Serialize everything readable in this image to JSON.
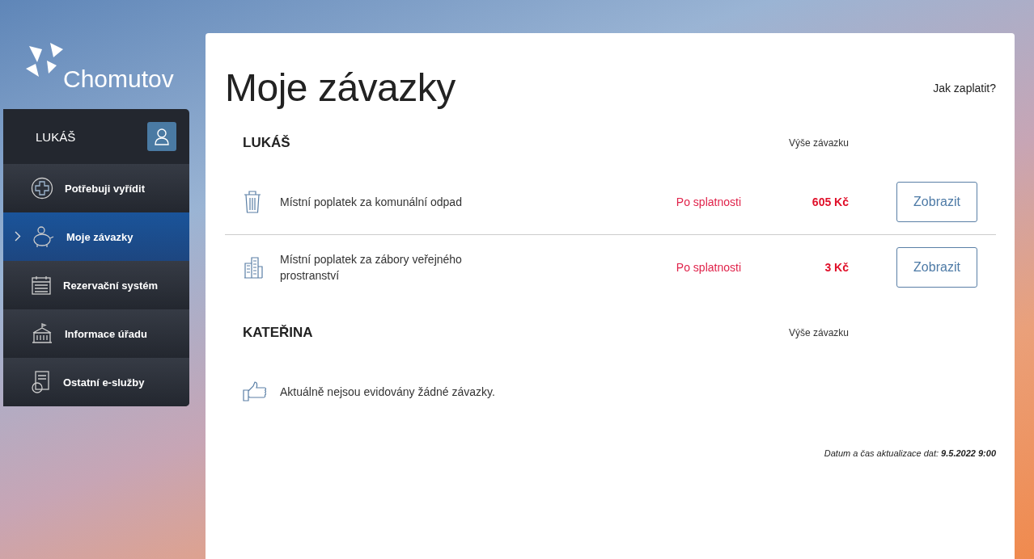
{
  "logo": {
    "text": "Chomutov"
  },
  "sidebar": {
    "user": "LUKÁŠ",
    "items": [
      {
        "label": "Potřebuji vyřídit",
        "kind": "plus",
        "selected": false
      },
      {
        "label": "Moje závazky",
        "kind": "piggy",
        "selected": true
      },
      {
        "label": "Rezervační systém",
        "kind": "calendar",
        "selected": false
      },
      {
        "label": "Informace úřadu",
        "kind": "building",
        "selected": false
      },
      {
        "label": "Ostatní e-služby",
        "kind": "document",
        "selected": false
      }
    ]
  },
  "main": {
    "title": "Moje závazky",
    "help_link": "Jak zaplatit?",
    "sections": [
      {
        "name": "LUKÁŠ",
        "amount_header": "Výše závazku",
        "items": [
          {
            "kind": "waste",
            "name": "Místní poplatek za komunální odpad",
            "status": "Po splatnosti",
            "amount": "605 Kč",
            "button": "Zobrazit"
          },
          {
            "kind": "buildings",
            "name": "Místní poplatek za zábory veřejného prostranství",
            "status": "Po splatnosti",
            "amount": "3 Kč",
            "button": "Zobrazit"
          }
        ]
      },
      {
        "name": "KATEŘINA",
        "amount_header": "Výše závazku",
        "empty_message": "Aktuálně nejsou evidovány žádné závazky."
      }
    ],
    "updated": "Datum a čas aktualizace dat: **9.5.2022 9:00**"
  }
}
